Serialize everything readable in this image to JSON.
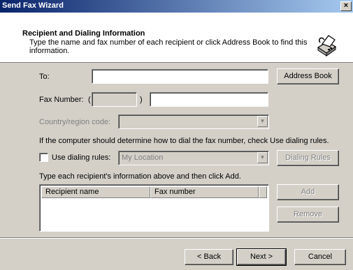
{
  "window": {
    "title": "Send Fax Wizard",
    "close_glyph": "×"
  },
  "header": {
    "title": "Recipient and Dialing Information",
    "description": "Type the name and fax number of each recipient or click Address Book to find this information.",
    "icon": "fax-machine-icon"
  },
  "form": {
    "to_label": "To:",
    "to_value": "",
    "address_book_label": "Address Book",
    "fax_number_label": "Fax Number:",
    "fax_open_paren": "(",
    "fax_close_paren": ")",
    "area_code_value": "",
    "fax_number_value": "",
    "country_label": "Country/region code:",
    "country_value": "",
    "dialing_hint": "If the computer should determine how to dial the fax number, check Use dialing rules.",
    "use_dialing_rules_label": "Use dialing rules:",
    "use_dialing_rules_checked": false,
    "location_value": "My Location",
    "dialing_rules_button": "Dialing Rules",
    "add_hint": "Type each recipient's information above and then click Add."
  },
  "recipients": {
    "columns": [
      "Recipient name",
      "Fax number"
    ],
    "rows": [],
    "add_label": "Add",
    "remove_label": "Remove"
  },
  "footer": {
    "back_label": "< Back",
    "next_label": "Next >",
    "cancel_label": "Cancel"
  }
}
